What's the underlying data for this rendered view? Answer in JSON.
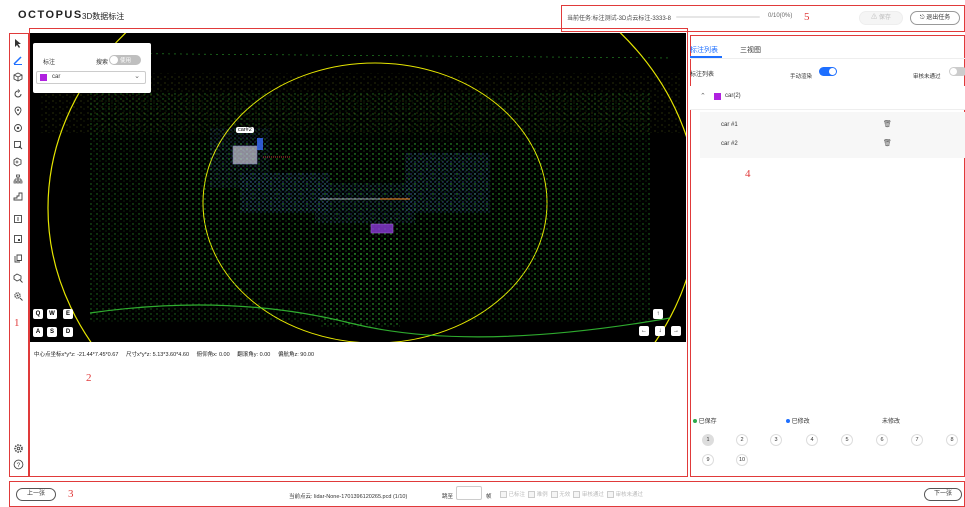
{
  "header": {
    "logo": "OCTOPUS",
    "subtitle": "3D数据标注",
    "task_text": "当前任务:标注测试-3D点云标注-3333-8",
    "progress_text": "0/10(0%)",
    "save_label": "⚠ 保存",
    "exit_label": "⎋ 退出任务"
  },
  "region_labels": {
    "r1": "1",
    "r2": "2",
    "r3": "3",
    "r4": "4",
    "r5": "5"
  },
  "toolbar": {
    "icons": [
      "cursor-icon",
      "pen-icon",
      "cube-icon",
      "rotate-icon",
      "pin-icon",
      "target-icon",
      "box-select-icon",
      "cube-plus-icon",
      "tree-icon",
      "stairs-icon",
      "frame-icon",
      "box-corner-icon",
      "copy-icon",
      "cube-search-icon",
      "gear-search-icon"
    ],
    "settings_icon": "gear-icon",
    "help_icon": "help-icon"
  },
  "panel": {
    "label_title": "标注",
    "search_label": "搜索",
    "search_toggle": "使用",
    "class_value": "car",
    "class_color": "#b021e0"
  },
  "viewer": {
    "box_label": "car#2",
    "keys_row1": [
      "Q",
      "W",
      "E"
    ],
    "keys_row2": [
      "A",
      "S",
      "D"
    ],
    "arrow_up": "↑",
    "arrow_left": "←",
    "arrow_down": "↓",
    "arrow_right": "→"
  },
  "coords": {
    "center": "中心点坐标x*y*z: -21.44*7.45*0.67",
    "size": "尺寸x*y*z: 5.13*3.60*4.60",
    "pitch": "俯仰角x: 0.00",
    "roll": "翻滚角y: 0.00",
    "yaw": "偏航角z: 90.00"
  },
  "right": {
    "tabs": [
      "标注列表",
      "三视图"
    ],
    "list_title": "标注列表",
    "manual_render": "手动渲染",
    "review_fail": "审核未通过",
    "group_name": "car(2)",
    "items": [
      "car #1",
      "car #2"
    ],
    "legend": {
      "saved": "已保存",
      "modified": "已修改",
      "unmodified": "未修改"
    },
    "legend_colors": {
      "saved": "#2ba84a",
      "modified": "#1e6fff"
    },
    "pages": [
      "1",
      "2",
      "3",
      "4",
      "5",
      "6",
      "7",
      "8",
      "9",
      "10"
    ]
  },
  "bottom": {
    "prev": "上一张",
    "next": "下一张",
    "cloud": "当前点云: lidar-None-1701396120265.pcd (1/10)",
    "jump": "跳至",
    "frame": "帧",
    "checks": [
      "已标注",
      "难例",
      "无效",
      "审核通过",
      "审核未通过"
    ]
  }
}
